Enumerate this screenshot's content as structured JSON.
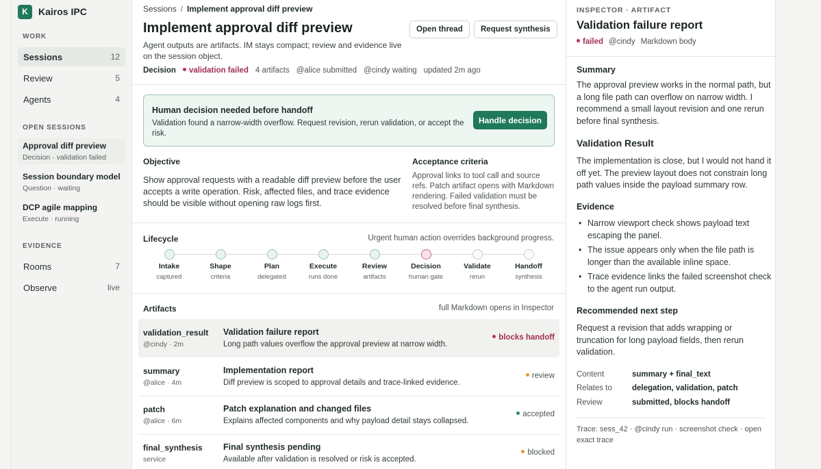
{
  "brand": {
    "logo_letter": "K",
    "name": "Kairos IPC",
    "color": "#1f7a5a"
  },
  "sidebar": {
    "work_label": "WORK",
    "work_items": [
      {
        "label": "Sessions",
        "count": "12"
      },
      {
        "label": "Review",
        "count": "5"
      },
      {
        "label": "Agents",
        "count": "4"
      }
    ],
    "open_label": "OPEN SESSIONS",
    "sessions": [
      {
        "title": "Approval diff preview",
        "sub": "Decision · validation failed"
      },
      {
        "title": "Session boundary model",
        "sub": "Question · waiting"
      },
      {
        "title": "DCP agile mapping",
        "sub": "Execute · running"
      }
    ],
    "evidence_label": "EVIDENCE",
    "evidence_items": [
      {
        "label": "Rooms",
        "count": "7"
      },
      {
        "label": "Observe",
        "count": "live"
      }
    ]
  },
  "main": {
    "breadcrumb": {
      "root": "Sessions",
      "sep": "/",
      "current": "Implement approval diff preview"
    },
    "title": "Implement approval diff preview",
    "subtitle": "Agent outputs are artifacts. IM stays compact; review and evidence live on the session object.",
    "buttons": {
      "open_thread": "Open thread",
      "request_synthesis": "Request synthesis"
    },
    "meta": {
      "label": "Decision",
      "status": "validation failed",
      "artifacts": "4 artifacts",
      "submitted": "@alice submitted",
      "waiting": "@cindy waiting",
      "updated": "updated 2m ago"
    },
    "decision": {
      "title": "Human decision needed before handoff",
      "text": "Validation found a narrow-width overflow. Request revision, rerun validation, or accept the risk.",
      "button": "Handle decision"
    },
    "objective": {
      "title": "Objective",
      "text": "Show approval requests with a readable diff preview before the user accepts a write operation. Risk, affected files, and trace evidence should be visible without opening raw logs first."
    },
    "acceptance": {
      "title": "Acceptance criteria",
      "text": "Approval links to tool call and source refs. Patch artifact opens with Markdown rendering. Failed validation must be resolved before final synthesis."
    },
    "lifecycle": {
      "title": "Lifecycle",
      "note": "Urgent human action overrides background progress.",
      "steps": [
        {
          "name": "Intake",
          "sub": "captured",
          "state": "done"
        },
        {
          "name": "Shape",
          "sub": "criteria",
          "state": "done"
        },
        {
          "name": "Plan",
          "sub": "delegated",
          "state": "done"
        },
        {
          "name": "Execute",
          "sub": "runs done",
          "state": "done"
        },
        {
          "name": "Review",
          "sub": "artifacts",
          "state": "done"
        },
        {
          "name": "Decision",
          "sub": "human gate",
          "state": "current"
        },
        {
          "name": "Validate",
          "sub": "rerun",
          "state": "pending"
        },
        {
          "name": "Handoff",
          "sub": "synthesis",
          "state": "pending"
        }
      ]
    },
    "artifacts": {
      "title": "Artifacts",
      "note": "full Markdown opens in Inspector",
      "rows": [
        {
          "name": "validation_result",
          "owner": "@cindy · 2m",
          "title": "Validation failure report",
          "desc": "Long path values overflow the approval preview at narrow width.",
          "status": "blocks handoff",
          "tone": "red"
        },
        {
          "name": "summary",
          "owner": "@alice · 4m",
          "title": "Implementation report",
          "desc": "Diff preview is scoped to approval details and trace-linked evidence.",
          "status": "review",
          "tone": "orange"
        },
        {
          "name": "patch",
          "owner": "@alice · 6m",
          "title": "Patch explanation and changed files",
          "desc": "Explains affected components and why payload detail stays collapsed.",
          "status": "accepted",
          "tone": "green"
        },
        {
          "name": "final_synthesis",
          "owner": "service",
          "title": "Final synthesis pending",
          "desc": "Available after validation is resolved or risk is accepted.",
          "status": "blocked",
          "tone": "orange"
        }
      ]
    }
  },
  "inspector": {
    "label": "INSPECTOR · ARTIFACT",
    "title": "Validation failure report",
    "status": "failed",
    "owner": "@cindy",
    "body_type": "Markdown body",
    "summary_h": "Summary",
    "summary": "The approval preview works in the normal path, but a long file path can overflow on narrow width. I recommend a small layout revision and one rerun before final synthesis.",
    "result_h": "Validation Result",
    "result": "The implementation is close, but I would not hand it off yet. The preview layout does not constrain long path values inside the payload summary row.",
    "evidence_h": "Evidence",
    "evidence": [
      "Narrow viewport check shows payload text escaping the panel.",
      "The issue appears only when the file path is longer than the available inline space.",
      "Trace evidence links the failed screenshot check to the agent run output."
    ],
    "next_h": "Recommended next step",
    "next": "Request a revision that adds wrapping or truncation for long payload fields, then rerun validation.",
    "kv": [
      {
        "k": "Content",
        "v": "summary + final_text"
      },
      {
        "k": "Relates to",
        "v": "delegation, validation, patch"
      },
      {
        "k": "Review",
        "v": "submitted, blocks handoff"
      }
    ],
    "trace": "Trace: sess_42 · @cindy run · screenshot check · open exact trace"
  }
}
